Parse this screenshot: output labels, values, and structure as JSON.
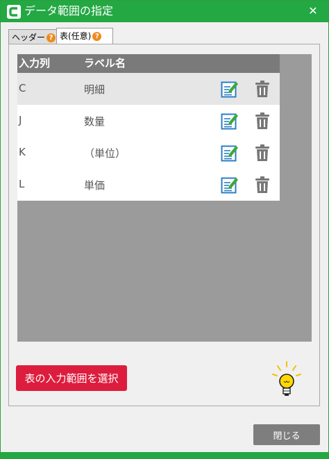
{
  "window": {
    "title": "データ範囲の指定",
    "close_glyph": "✕"
  },
  "tabs": [
    {
      "label": "ヘッダー",
      "help": "?"
    },
    {
      "label": "表(任意)",
      "help": "?"
    }
  ],
  "table": {
    "headers": [
      "入力列",
      "ラベル名"
    ],
    "rows": [
      {
        "column": "C",
        "label": "明細"
      },
      {
        "column": "J",
        "label": "数量"
      },
      {
        "column": "K",
        "label": "（単位）"
      },
      {
        "column": "L",
        "label": "単価"
      }
    ]
  },
  "buttons": {
    "select_range": "表の入力範囲を選択",
    "close": "閉じる"
  },
  "icons": [
    "app-logo-icon",
    "edit-icon",
    "trash-icon",
    "lightbulb-icon"
  ],
  "colors": {
    "title_bar": "#23a843",
    "select_button": "#dc1d3d",
    "help_badge": "#f08a1c",
    "edit_icon": "#2a7fc7",
    "edit_pencil": "#3aa935"
  }
}
